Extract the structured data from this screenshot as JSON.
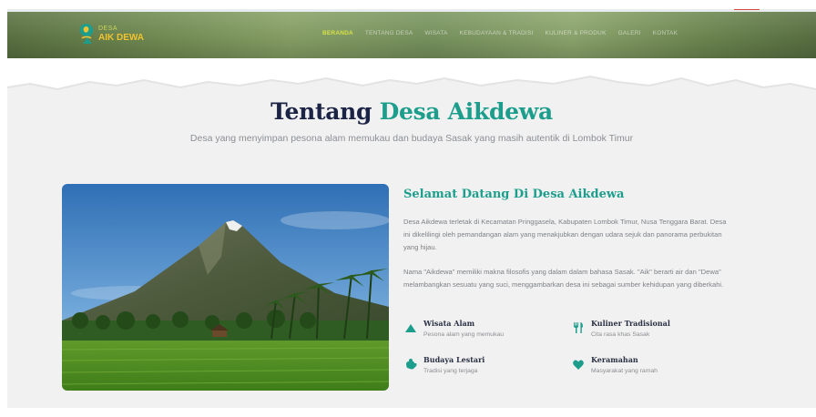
{
  "header": {
    "logo": {
      "top": "DESA",
      "bottom": "AIK DEWA",
      "icon": "logo-icon"
    },
    "nav": [
      {
        "label": "BERANDA",
        "active": true
      },
      {
        "label": "TENTANG DESA",
        "active": false
      },
      {
        "label": "WISATA",
        "active": false
      },
      {
        "label": "KEBUDAYAAN & TRADISI",
        "active": false
      },
      {
        "label": "KULINER & PRODUK",
        "active": false
      },
      {
        "label": "GALERI",
        "active": false
      },
      {
        "label": "KONTAK",
        "active": false
      }
    ]
  },
  "section": {
    "title_prefix": "Tentang",
    "title_accent": "Desa Aikdewa",
    "subtitle": "Desa yang menyimpan pesona alam memukau dan budaya Sasak yang masih autentik di Lombok Timur"
  },
  "about": {
    "welcome": "Selamat Datang Di Desa Aikdewa",
    "p1": "Desa Aikdewa terletak di Kecamatan Pringgasela, Kabupaten Lombok Timur, Nusa Tenggara Barat. Desa ini dikelilingi oleh pemandangan alam yang menakjubkan dengan udara sejuk dan panorama perbukitan yang hijau.",
    "p2": "Nama \"Aikdewa\" memiliki makna filosofis yang dalam dalam bahasa Sasak. \"Aik\" berarti air dan \"Dewa\" melambangkan sesuatu yang suci, menggambarkan desa ini sebagai sumber kehidupan yang diberkahi.",
    "features": [
      {
        "title": "Wisata Alam",
        "desc": "Pesona alam yang memukau",
        "icon": "mountain-icon"
      },
      {
        "title": "Kuliner Tradisional",
        "desc": "Cita rasa khas Sasak",
        "icon": "utensils-icon"
      },
      {
        "title": "Budaya Lestari",
        "desc": "Tradisi yang terjaga",
        "icon": "hands-icon"
      },
      {
        "title": "Keramahan",
        "desc": "Masyarakat yang ramah",
        "icon": "heart-icon"
      }
    ]
  },
  "colors": {
    "accent": "#1d9e8d",
    "heading": "#1c2445",
    "nav_active": "#d7e04a",
    "logo_yellow": "#f1c232"
  }
}
